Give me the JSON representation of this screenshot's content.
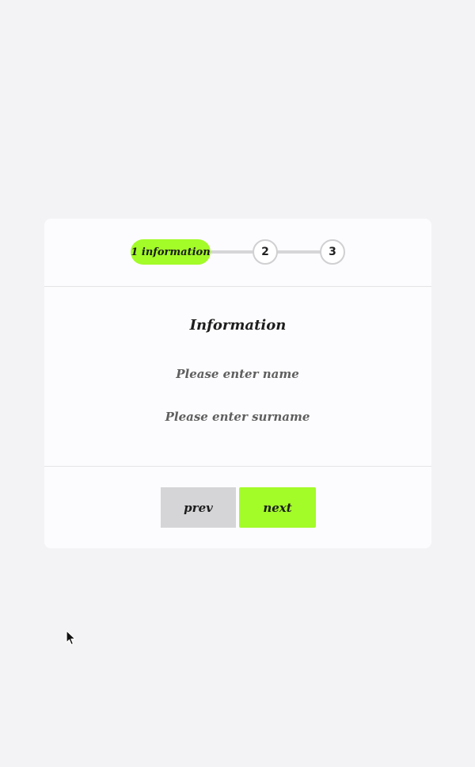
{
  "stepper": {
    "active_step_label": "1 information",
    "step_2_label": "2",
    "step_3_label": "3"
  },
  "form": {
    "title": "Information",
    "name_placeholder": "Please enter name",
    "name_value": "",
    "surname_placeholder": "Please enter surname",
    "surname_value": ""
  },
  "footer": {
    "prev_label": "prev",
    "next_label": "next"
  },
  "colors": {
    "accent": "#a3fb28",
    "background": "#f3f2f4",
    "card": "#fcfbfd",
    "secondary_button": "#d5d4d6"
  },
  "icons": {
    "cursor": "mouse-pointer-icon"
  }
}
